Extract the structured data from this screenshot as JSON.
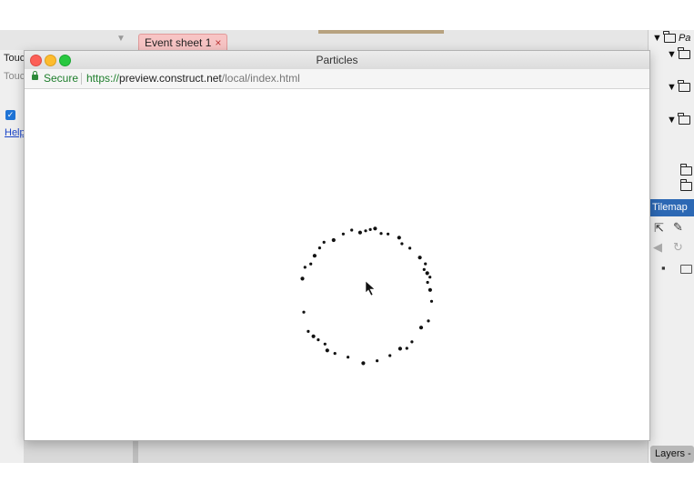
{
  "editor": {
    "left_panel": {
      "row1_label": "Touc",
      "row2_label": "Touc",
      "help_link": "Help",
      "checkbox_checked": true
    },
    "tab": {
      "label": "Event sheet 1",
      "close_glyph": "×",
      "color": "#f7c4c4"
    },
    "right_panel": {
      "tree": [
        {
          "label": "Pa",
          "expanded": true
        },
        {
          "label": "",
          "expanded": true
        },
        {
          "label": "",
          "expanded": true
        },
        {
          "label": "",
          "expanded": true
        },
        {
          "label": "",
          "expanded": false
        },
        {
          "label": "",
          "expanded": false
        }
      ],
      "tilemap_title": "Tilemap",
      "layers_label": "Layers -",
      "tool_icons": [
        "pointer-icon",
        "pencil-icon",
        "eraser-icon",
        "rotate-icon",
        "save-icon",
        "folder-icon"
      ]
    }
  },
  "preview": {
    "window_title": "Particles",
    "secure_label": "Secure",
    "url_scheme": "https://",
    "url_host": "preview.construct.net",
    "url_path": "/local/index.html",
    "particle_color": "#111111"
  }
}
